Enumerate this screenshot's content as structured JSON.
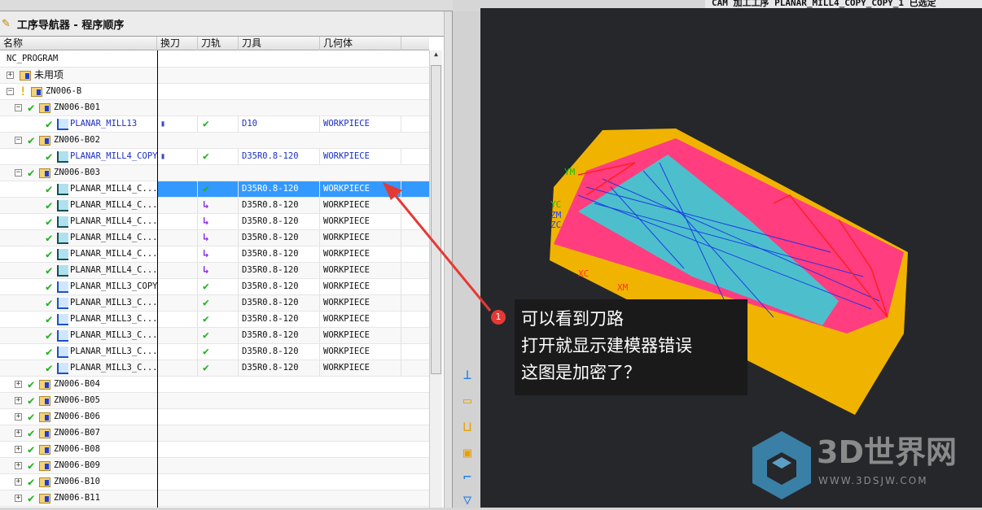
{
  "status_bar": "CAM 加工工序 PLANAR_MILL4_COPY_COPY_1 已选定",
  "navigator": {
    "title": "工序导航器 - 程序顺序",
    "columns": [
      "名称",
      "换刀",
      "刀轨",
      "刀具",
      "几何体"
    ],
    "rows": [
      {
        "name": "NC_PROGRAM",
        "level": 0,
        "type": "root"
      },
      {
        "name": "未用项",
        "level": 1,
        "type": "group",
        "toggle": "+",
        "cn": true
      },
      {
        "name": "ZN006-B",
        "level": 1,
        "type": "group",
        "toggle": "-",
        "warn": true
      },
      {
        "name": "ZN006-B01",
        "level": 2,
        "type": "group",
        "toggle": "-",
        "check": true
      },
      {
        "name": "PLANAR_MILL13",
        "level": 3,
        "type": "op",
        "check": true,
        "toolchange": true,
        "path": "check",
        "tool": "D10",
        "geom": "WORKPIECE",
        "blue": true
      },
      {
        "name": "ZN006-B02",
        "level": 2,
        "type": "group",
        "toggle": "-",
        "check": true
      },
      {
        "name": "PLANAR_MILL4_COPY",
        "level": 3,
        "type": "op",
        "check": true,
        "toolchange": true,
        "path": "check",
        "tool": "D35R0.8-120",
        "geom": "WORKPIECE",
        "blue": true,
        "dark": true
      },
      {
        "name": "ZN006-B03",
        "level": 2,
        "type": "group",
        "toggle": "-",
        "check": true
      },
      {
        "name": "PLANAR_MILL4_C...",
        "level": 3,
        "type": "op",
        "check": true,
        "path": "check",
        "tool": "D35R0.8-120",
        "geom": "WORKPIECE",
        "selected": true,
        "dark": true
      },
      {
        "name": "PLANAR_MILL4_C...",
        "level": 3,
        "type": "op",
        "check": true,
        "path": "arrow",
        "tool": "D35R0.8-120",
        "geom": "WORKPIECE",
        "dark": true
      },
      {
        "name": "PLANAR_MILL4_C...",
        "level": 3,
        "type": "op",
        "check": true,
        "path": "arrow",
        "tool": "D35R0.8-120",
        "geom": "WORKPIECE",
        "dark": true
      },
      {
        "name": "PLANAR_MILL4_C...",
        "level": 3,
        "type": "op",
        "check": true,
        "path": "arrow",
        "tool": "D35R0.8-120",
        "geom": "WORKPIECE",
        "dark": true
      },
      {
        "name": "PLANAR_MILL4_C...",
        "level": 3,
        "type": "op",
        "check": true,
        "path": "arrow",
        "tool": "D35R0.8-120",
        "geom": "WORKPIECE",
        "dark": true
      },
      {
        "name": "PLANAR_MILL4_C...",
        "level": 3,
        "type": "op",
        "check": true,
        "path": "arrow",
        "tool": "D35R0.8-120",
        "geom": "WORKPIECE",
        "dark": true
      },
      {
        "name": "PLANAR_MILL3_COPY",
        "level": 3,
        "type": "op",
        "check": true,
        "path": "check",
        "tool": "D35R0.8-120",
        "geom": "WORKPIECE"
      },
      {
        "name": "PLANAR_MILL3_C...",
        "level": 3,
        "type": "op",
        "check": true,
        "path": "check",
        "tool": "D35R0.8-120",
        "geom": "WORKPIECE"
      },
      {
        "name": "PLANAR_MILL3_C...",
        "level": 3,
        "type": "op",
        "check": true,
        "path": "check",
        "tool": "D35R0.8-120",
        "geom": "WORKPIECE"
      },
      {
        "name": "PLANAR_MILL3_C...",
        "level": 3,
        "type": "op",
        "check": true,
        "path": "check",
        "tool": "D35R0.8-120",
        "geom": "WORKPIECE"
      },
      {
        "name": "PLANAR_MILL3_C...",
        "level": 3,
        "type": "op",
        "check": true,
        "path": "check",
        "tool": "D35R0.8-120",
        "geom": "WORKPIECE"
      },
      {
        "name": "PLANAR_MILL3_C...",
        "level": 3,
        "type": "op",
        "check": true,
        "path": "check",
        "tool": "D35R0.8-120",
        "geom": "WORKPIECE"
      },
      {
        "name": "ZN006-B04",
        "level": 2,
        "type": "group",
        "toggle": "+",
        "check": true
      },
      {
        "name": "ZN006-B05",
        "level": 2,
        "type": "group",
        "toggle": "+",
        "check": true
      },
      {
        "name": "ZN006-B06",
        "level": 2,
        "type": "group",
        "toggle": "+",
        "check": true
      },
      {
        "name": "ZN006-B07",
        "level": 2,
        "type": "group",
        "toggle": "+",
        "check": true
      },
      {
        "name": "ZN006-B08",
        "level": 2,
        "type": "group",
        "toggle": "+",
        "check": true
      },
      {
        "name": "ZN006-B09",
        "level": 2,
        "type": "group",
        "toggle": "+",
        "check": true
      },
      {
        "name": "ZN006-B10",
        "level": 2,
        "type": "group",
        "toggle": "+",
        "check": true
      },
      {
        "name": "ZN006-B11",
        "level": 2,
        "type": "group",
        "toggle": "+",
        "check": true
      }
    ]
  },
  "viewport": {
    "axis_labels": [
      "YM",
      "YC",
      "ZM",
      "ZC",
      "XC",
      "XM"
    ]
  },
  "annotation": {
    "number": "1",
    "lines": [
      "可以看到刀路",
      "打开就显示建模器错误",
      "这图是加密了？"
    ]
  },
  "watermark": {
    "brand": "3D世界网",
    "url": "WWW.3DSJW.COM"
  },
  "colors": {
    "selection": "#3399ff",
    "check": "#22b022",
    "arrow": "#8a2be2",
    "annotation": "#e53935"
  }
}
